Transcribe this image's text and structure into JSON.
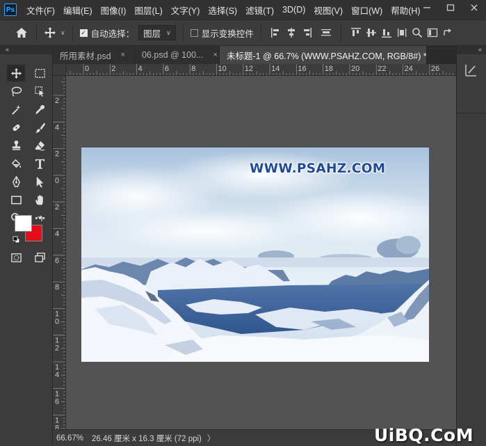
{
  "app": {
    "logo_text": "Ps"
  },
  "menu": [
    "文件(F)",
    "编辑(E)",
    "图像(I)",
    "图层(L)",
    "文字(Y)",
    "选择(S)",
    "滤镜(T)",
    "3D(D)",
    "视图(V)",
    "窗口(W)",
    "帮助(H)"
  ],
  "options": {
    "auto_select_label": "自动选择：",
    "auto_select_checked": true,
    "auto_select_target": "图层",
    "show_transform_label": "显示变换控件",
    "show_transform_checked": false
  },
  "panels": {
    "collapse_left": "«",
    "collapse_right": "«"
  },
  "tabs": [
    {
      "label": "所用素材.psd",
      "active": false
    },
    {
      "label": "06.psd @ 100...",
      "active": false
    },
    {
      "label": "未标题-1 @ 66.7% (WWW.PSAHZ.COM, RGB/8#) *",
      "active": true
    }
  ],
  "tab_close": "×",
  "rulers": {
    "horizontal": [
      "0",
      "2",
      "4",
      "6",
      "8",
      "10",
      "12",
      "14",
      "16",
      "18",
      "20",
      "22",
      "24",
      "26"
    ],
    "vertical": [
      "2",
      "4",
      "2",
      "0",
      "2",
      "4",
      "6",
      "8",
      "10",
      "12",
      "14",
      "16",
      "18",
      "20"
    ]
  },
  "canvas": {
    "watermark": "WWW.PSAHZ.COM"
  },
  "colors": {
    "foreground": "#ffffff",
    "background": "#e50d17"
  },
  "status": {
    "zoom": "66.67%",
    "doc_info": "26.46 厘米 x 16.3 厘米 (72 ppi)",
    "arrow": "〉"
  },
  "site_logo": "UiBQ.CoM"
}
